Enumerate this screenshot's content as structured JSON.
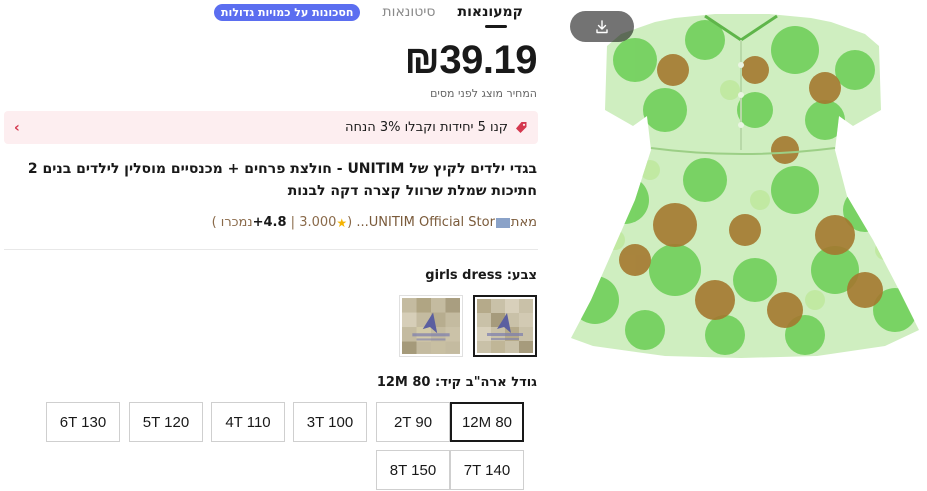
{
  "tabs": {
    "items": [
      {
        "label": "קמעונאות"
      },
      {
        "label": "סיטונאות"
      }
    ],
    "bulk_badge": "חסכונות על כמויות גדולות"
  },
  "price": {
    "amount": "₪39.19",
    "note": "המחיר מוצג לפני מסים"
  },
  "promo": {
    "text": "קנו 5 יחידות וקבלו 3% הנחה"
  },
  "product": {
    "title": "בגדי ילדים לקיץ של UNITIM - חולצת פרחים + מכנסיים מוסלין לילדים בנים 2 חתיכות שמלת שרוול קצרה דקה לבנות"
  },
  "store": {
    "prefix": "מאת",
    "name": "UNITIM Official Stor...",
    "count": "3.000",
    "rating": "4.8+",
    "sold": "נמכרו"
  },
  "color": {
    "label": "צבע:",
    "value": "girls dress"
  },
  "size": {
    "label": "גודל ארה\"ב קיד:",
    "value": "12M 80",
    "options": [
      {
        "label": "12M 80",
        "selected": true
      },
      {
        "label": "2T 90"
      },
      {
        "label": "3T 100"
      },
      {
        "label": "4T 110"
      },
      {
        "label": "5T 120"
      },
      {
        "label": "6T 130"
      },
      {
        "label": "7T 140"
      },
      {
        "label": "8T 150"
      }
    ]
  },
  "colors": {
    "bulk_badge_bg": "#5b6ef0",
    "promo_bg": "#fdeef0",
    "promo_accent": "#d4374e",
    "dress_green": "#7ed36a",
    "dress_brown": "#a87a3a"
  },
  "icons": {
    "download": "download-icon",
    "promo_tag": "tag-icon",
    "chevron": "chevron-right-icon",
    "star": "star-icon"
  }
}
